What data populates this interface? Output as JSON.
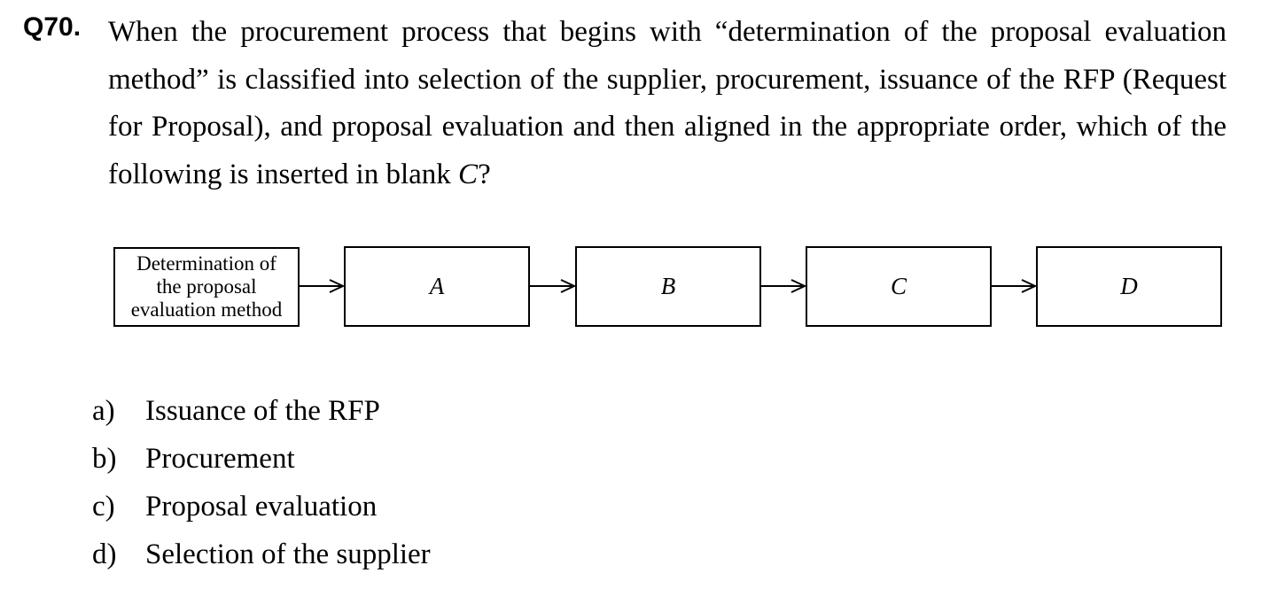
{
  "question": {
    "number": "Q70.",
    "stem_before_var": "When the procurement process that begins with “determination of the proposal evaluation method” is classified into selection of the supplier, procurement, issuance of the RFP (Request for Proposal), and proposal evaluation and then aligned in the appropriate order, which of the following is inserted in blank ",
    "stem_var": "C",
    "stem_after_var": "?"
  },
  "diagram": {
    "start_lines": [
      "Determination of",
      "the proposal",
      "evaluation method"
    ],
    "blanks": [
      "A",
      "B",
      "C",
      "D"
    ]
  },
  "options": [
    {
      "letter": "a)",
      "text": "Issuance of the RFP"
    },
    {
      "letter": "b)",
      "text": "Procurement"
    },
    {
      "letter": "c)",
      "text": "Proposal evaluation"
    },
    {
      "letter": "d)",
      "text": "Selection of the supplier"
    }
  ]
}
